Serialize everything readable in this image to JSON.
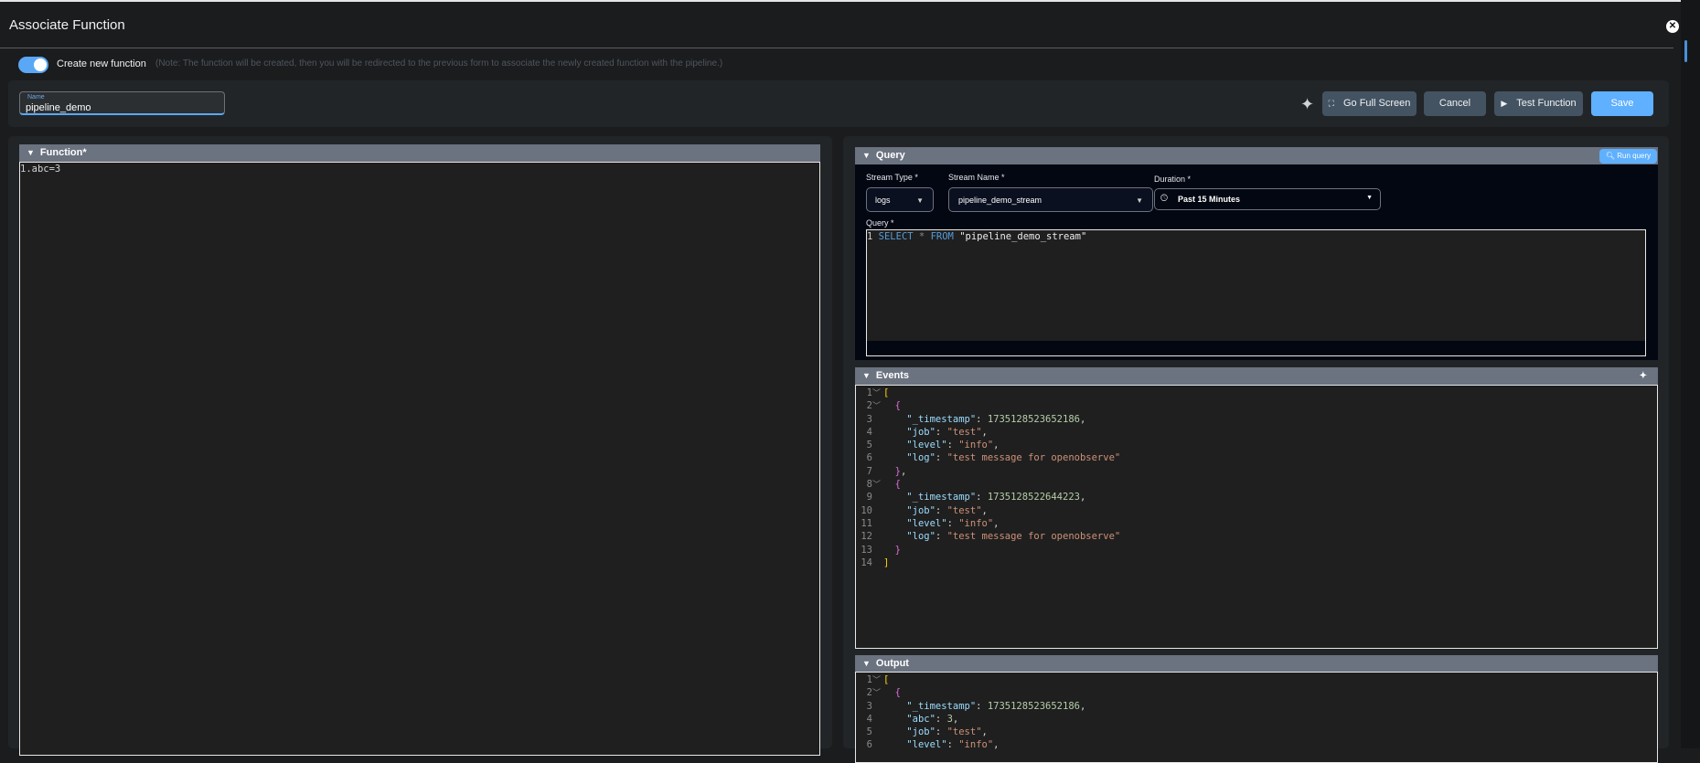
{
  "dialog": {
    "title": "Associate Function",
    "close_icon": "close-circle-icon"
  },
  "toggle": {
    "label": "Create new function",
    "on": true,
    "note": "(Note: The function will be created, then you will be redirected to the previous form to associate the newly created function with the pipeline.)"
  },
  "name_field": {
    "label": "Name",
    "value": "pipeline_demo"
  },
  "toolbar": {
    "ai_icon": "sparkle-icon",
    "fullscreen_label": "Go Full Screen",
    "cancel_label": "Cancel",
    "test_label": "Test Function",
    "save_label": "Save"
  },
  "function_panel": {
    "title": "Function*",
    "lines": [
      ".abc=3"
    ]
  },
  "query_panel": {
    "title": "Query",
    "run_label": "Run query",
    "stream_type": {
      "label": "Stream Type *",
      "value": "logs"
    },
    "stream_name": {
      "label": "Stream Name *",
      "value": "pipeline_demo_stream"
    },
    "duration": {
      "label": "Duration *",
      "value": "Past 15 Minutes"
    },
    "query_label": "Query *",
    "query_kw1": "SELECT",
    "query_star": "*",
    "query_kw2": "FROM",
    "query_str": "\"pipeline_demo_stream\""
  },
  "events_panel": {
    "title": "Events"
  },
  "output_panel": {
    "title": "Output"
  },
  "events": [
    {
      "ts": "1735128523652186",
      "job": "test",
      "level": "info",
      "log": "test message for openobserve"
    },
    {
      "ts": "1735128522644223",
      "job": "test",
      "level": "info",
      "log": "test message for openobserve"
    }
  ],
  "output": {
    "ts": "1735128523652186",
    "abc": "3",
    "job": "test",
    "level": "info"
  },
  "colors": {
    "accent": "#5fb0ff",
    "panel_header": "#6b7280",
    "button": "#445362"
  }
}
